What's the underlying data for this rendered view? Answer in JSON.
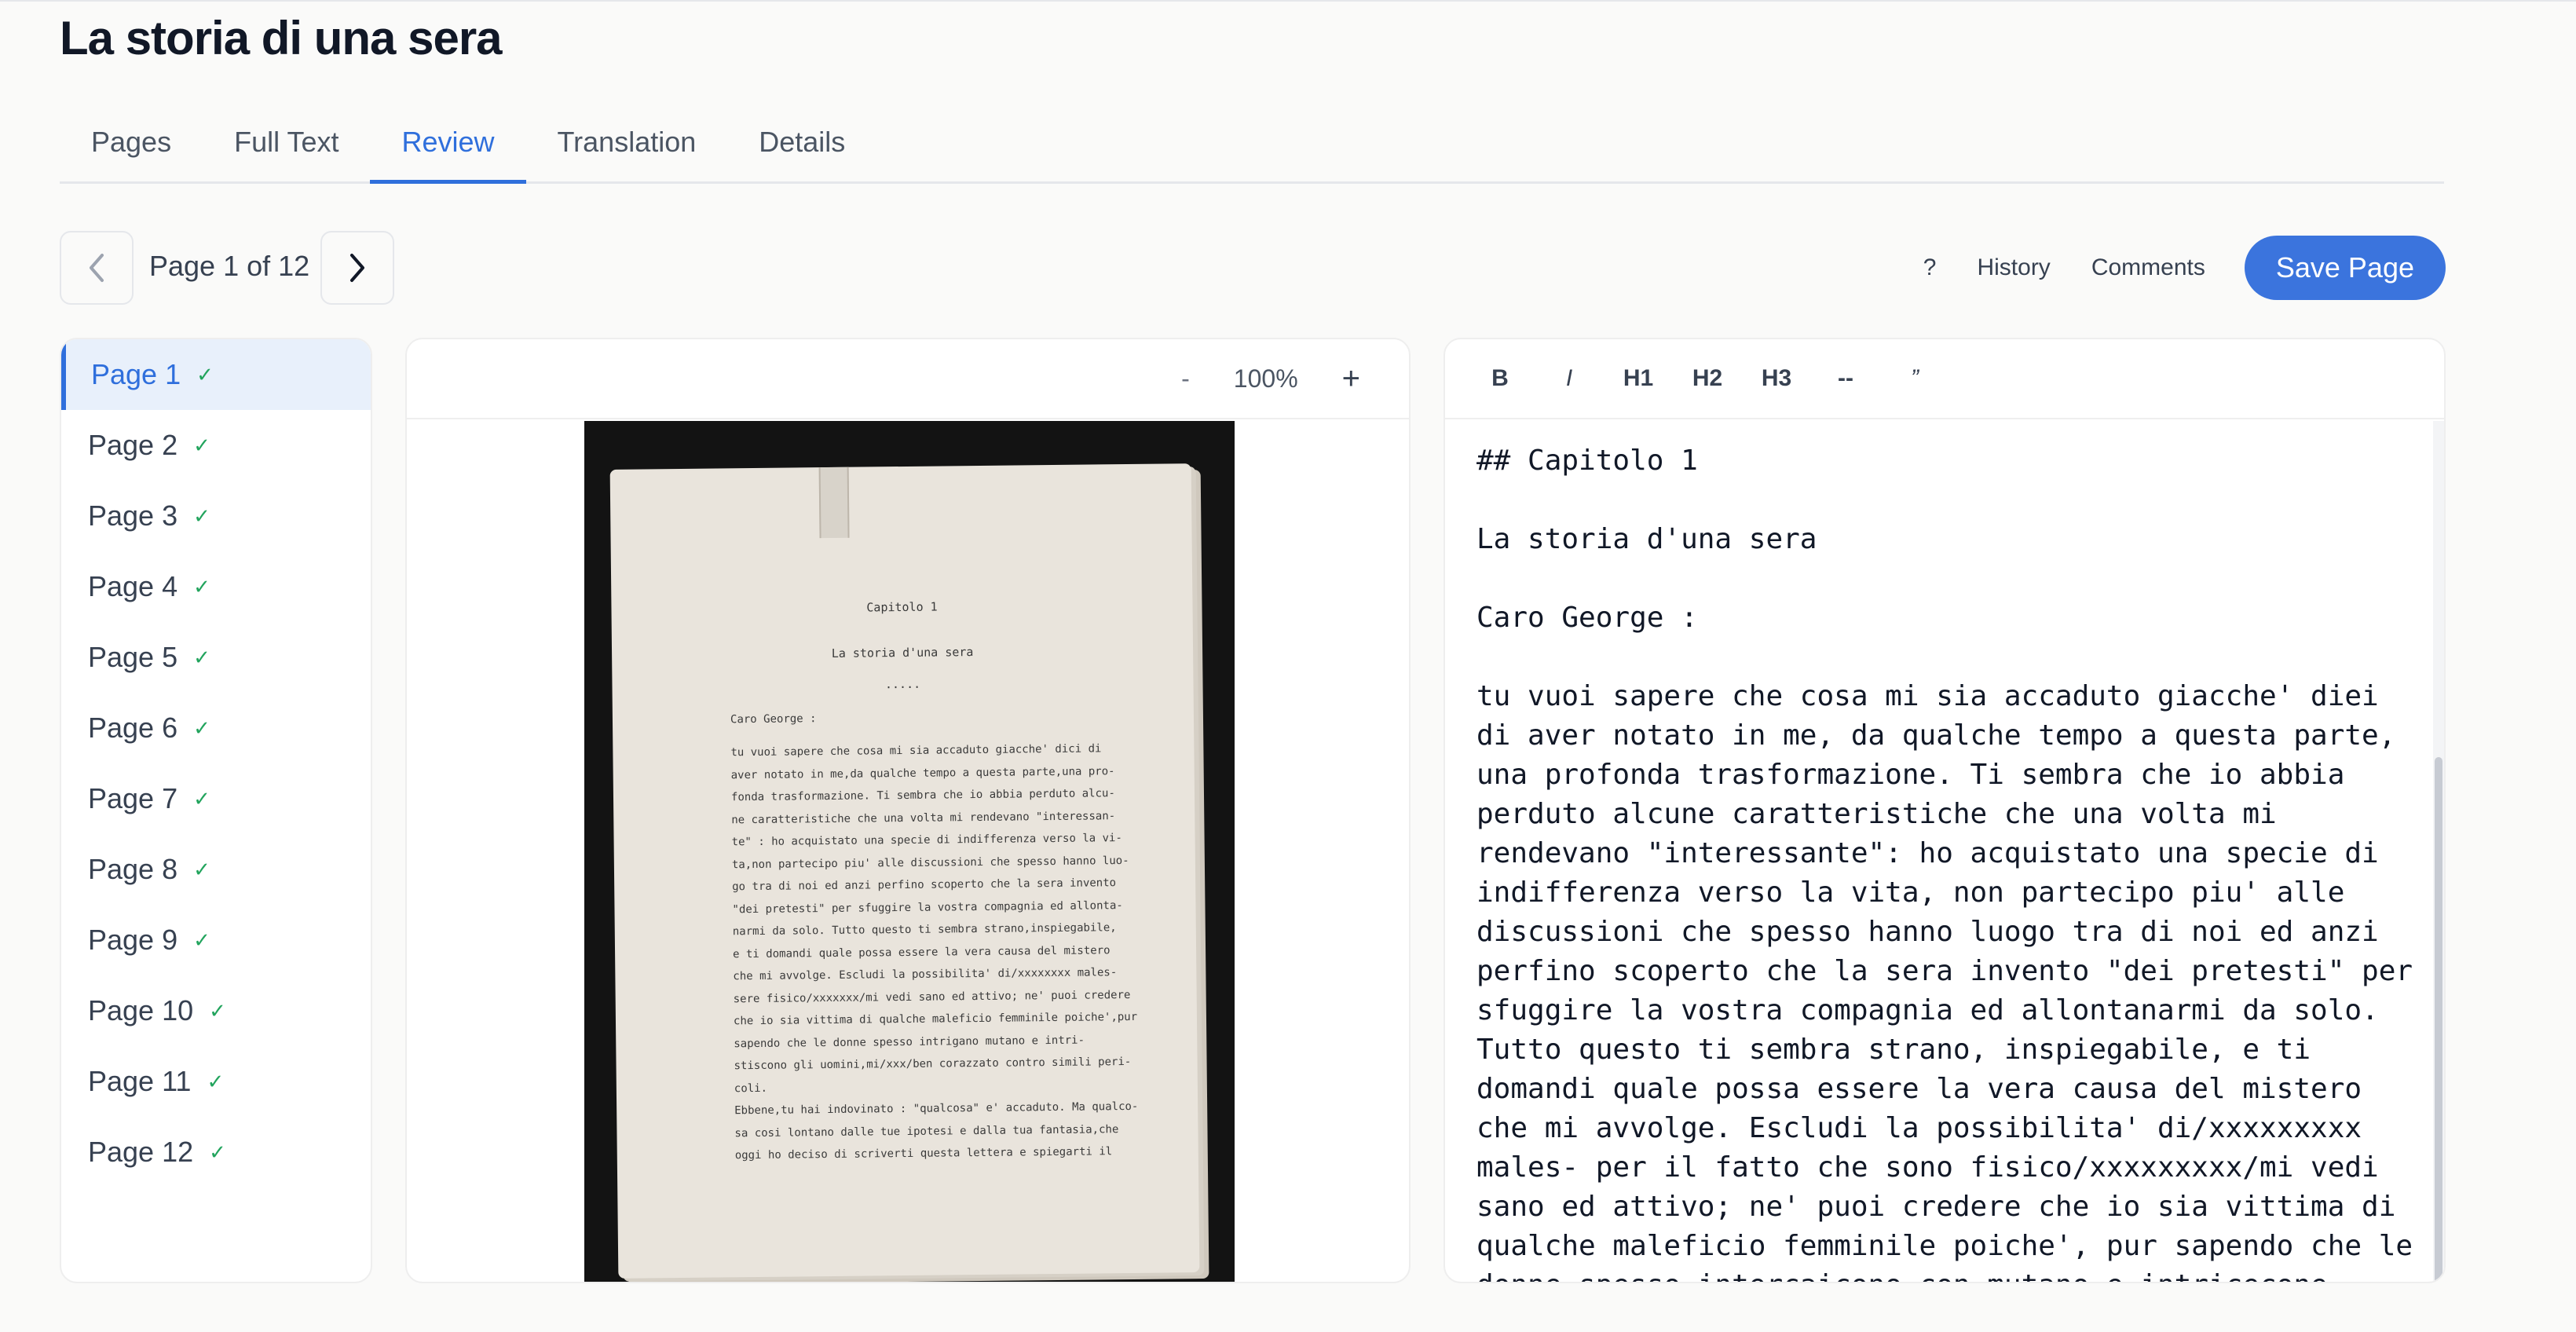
{
  "document": {
    "title": "La storia di una sera"
  },
  "tabs": [
    {
      "label": "Pages"
    },
    {
      "label": "Full Text"
    },
    {
      "label": "Review",
      "active": true
    },
    {
      "label": "Translation"
    },
    {
      "label": "Details"
    }
  ],
  "pager": {
    "label": "Page 1 of 12"
  },
  "actions": {
    "help": "?",
    "history": "History",
    "comments": "Comments",
    "save": "Save Page"
  },
  "sidebar": {
    "items": [
      {
        "label": "Page 1",
        "check": "✓"
      },
      {
        "label": "Page 2",
        "check": "✓"
      },
      {
        "label": "Page 3",
        "check": "✓"
      },
      {
        "label": "Page 4",
        "check": "✓"
      },
      {
        "label": "Page 5",
        "check": "✓"
      },
      {
        "label": "Page 6",
        "check": "✓"
      },
      {
        "label": "Page 7",
        "check": "✓"
      },
      {
        "label": "Page 8",
        "check": "✓"
      },
      {
        "label": "Page 9",
        "check": "✓"
      },
      {
        "label": "Page 10",
        "check": "✓"
      },
      {
        "label": "Page 11",
        "check": "✓"
      },
      {
        "label": "Page 12",
        "check": "✓"
      }
    ]
  },
  "viewer": {
    "zoom_out": "-",
    "zoom": "100%",
    "zoom_in": "+"
  },
  "scan": {
    "chapter": "Capitolo 1",
    "heading": "La storia d'una sera",
    "dots": ".....",
    "greeting": "Caro George :",
    "body": "tu vuoi sapere che cosa mi sia accaduto giacche' dici di\naver notato in me,da qualche tempo a questa parte,una pro-\nfonda trasformazione. Ti sembra che io abbia perduto alcu-\nne caratteristiche che una volta mi rendevano \"interessan-\nte\" : ho acquistato una specie di indifferenza verso la vi-\nta,non partecipo piu' alle discussioni che spesso hanno luo-\ngo tra di noi ed anzi perfino scoperto che la sera invento\n\"dei pretesti\" per sfuggire la vostra compagnia ed allonta-\nnarmi da solo. Tutto questo ti sembra strano,inspiegabile,\ne ti domandi quale possa essere la vera causa del mistero\nche mi avvolge. Escludi la possibilita' di/xxxxxxxx males-\nsere fisico/xxxxxxx/mi vedi sano ed attivo; ne' puoi credere\nche io sia vittima di qualche maleficio femminile poiche',pur\nsapendo che le donne spesso intrigano mutano e intri-\nstiscono gli uomini,mi/xxx/ben corazzato contro simili peri-\ncoli.\nEbbene,tu hai indovinato : \"qualcosa\" e' accaduto. Ma qualco-\nsa cosi lontano dalle tue ipotesi e dalla tua fantasia,che\noggi ho deciso di scriverti questa lettera e spiegarti il"
  },
  "editor": {
    "toolbar": {
      "bold": "B",
      "italic": "I",
      "h1": "H1",
      "h2": "H2",
      "h3": "H3",
      "hr": "--",
      "quote": "”"
    },
    "content": "## Capitolo 1\n\nLa storia d'una sera\n\nCaro George :\n\ntu vuoi sapere che cosa mi sia accaduto giacche' diei\ndi aver notato in me, da qualche tempo a questa parte,\nuna profonda trasformazione. Ti sembra che io abbia\nperduto alcune caratteristiche che una volta mi\nrendevano \"interessante\": ho acquistato una specie di\nindifferenza verso la vita, non partecipo piu' alle\ndiscussioni che spesso hanno luogo tra di noi ed anzi\nperfino scoperto che la sera invento \"dei pretesti\" per\nsfuggire la vostra compagnia ed allontanarmi da solo.\nTutto questo ti sembra strano, inspiegabile, e ti\ndomandi quale possa essere la vera causa del mistero\nche mi avvolge. Escludi la possibilita' di/xxxxxxxxx\nmales- per il fatto che sono fisico/xxxxxxxxx/mi vedi\nsano ed attivo; ne' puoi credere che io sia vittima di\nqualche maleficio femminile poiche', pur sapendo che le\ndonne spesso intercaicono con mutano e intricecone"
  },
  "colors": {
    "accent": "#3b74dd",
    "check": "#22a45d",
    "active_bg": "#e8f0fb"
  }
}
